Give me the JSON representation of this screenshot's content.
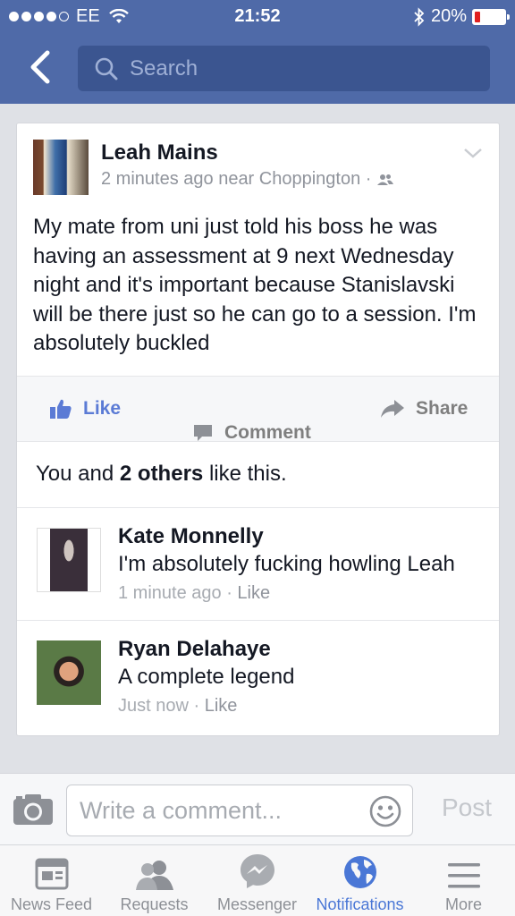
{
  "status_bar": {
    "carrier": "EE",
    "time": "21:52",
    "battery": "20%"
  },
  "nav": {
    "search_placeholder": "Search"
  },
  "post": {
    "author": "Leah Mains",
    "meta": "2 minutes ago near Choppington ·",
    "text": "My mate from uni just told his boss he was having an assessment at 9 next Wednesday night and it's important because Stanislavski will be there just so he can go to a session. I'm absolutely buckled",
    "actions": {
      "like": "Like",
      "comment": "Comment",
      "share": "Share"
    },
    "likes": {
      "prefix": "You and",
      "others": "2 others",
      "suffix": "like this."
    },
    "comments": [
      {
        "name": "Kate Monnelly",
        "text": "I'm absolutely fucking howling Leah",
        "time": "1 minute ago",
        "sep": " · ",
        "like": "Like"
      },
      {
        "name": "Ryan Delahaye",
        "text": "A complete legend",
        "time": "Just now",
        "sep": " · ",
        "like": "Like"
      }
    ]
  },
  "composer": {
    "placeholder": "Write a comment...",
    "post_label": "Post"
  },
  "tabs": [
    {
      "label": "News Feed",
      "icon": "news-feed-icon"
    },
    {
      "label": "Requests",
      "icon": "friends-icon"
    },
    {
      "label": "Messenger",
      "icon": "messenger-icon"
    },
    {
      "label": "Notifications",
      "icon": "globe-icon",
      "active": true
    },
    {
      "label": "More",
      "icon": "menu-icon"
    }
  ],
  "colors": {
    "brand": "#4f6aa8",
    "link": "#5b7bd5",
    "active_tab": "#4a77d6",
    "battery_low": "#e02020"
  }
}
